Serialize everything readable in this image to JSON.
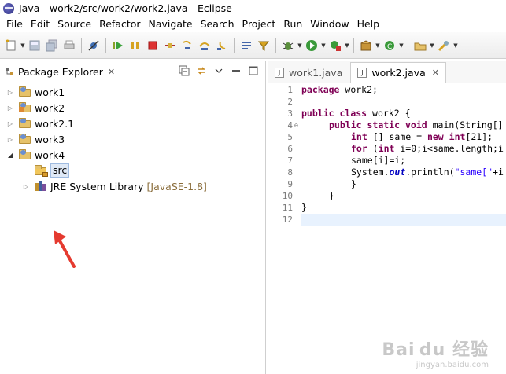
{
  "window": {
    "title": "Java - work2/src/work2/work2.java - Eclipse"
  },
  "menu": [
    "File",
    "Edit",
    "Source",
    "Refactor",
    "Navigate",
    "Search",
    "Project",
    "Run",
    "Window",
    "Help"
  ],
  "package_explorer": {
    "title": "Package Explorer",
    "close_glyph": "✕",
    "projects": [
      {
        "label": "work1",
        "expanded": false
      },
      {
        "label": "work2",
        "expanded": false
      },
      {
        "label": "work2.1",
        "expanded": false
      },
      {
        "label": "work3",
        "expanded": false
      },
      {
        "label": "work4",
        "expanded": true
      }
    ],
    "src_label": "src",
    "library": {
      "label": "JRE System Library",
      "version": "[JavaSE-1.8]"
    }
  },
  "editor": {
    "tabs": [
      {
        "label": "work1.java",
        "active": false
      },
      {
        "label": "work2.java",
        "active": true,
        "close_glyph": "✕"
      }
    ],
    "line_numbers": [
      "1",
      "2",
      "3",
      "4",
      "5",
      "6",
      "7",
      "8",
      "9",
      "10",
      "11",
      "12"
    ],
    "lines": {
      "l1_kw": "package",
      "l1_rest": " work2;",
      "l3_kw1": "public",
      "l3_kw2": "class",
      "l3_rest": " work2 {",
      "l4_kw1": "public",
      "l4_kw2": "static",
      "l4_kw3": "void",
      "l4_rest": " main(String[]",
      "l5_kw": "int",
      "l5_mid": " [] same = ",
      "l5_kw2": "new",
      "l5_kw3": "int",
      "l5_rest": "[21];",
      "l6_kw": "for",
      "l6_mid": " (",
      "l6_kw2": "int",
      "l6_rest": " i=0;i<same.length;i",
      "l7_text": "same[i]=i;",
      "l8_a": "System.",
      "l8_out": "out",
      "l8_b": ".println(",
      "l8_str": "\"same[\"",
      "l8_c": "+i",
      "l9_text": "}",
      "l10_text": "}",
      "l11_text": "}"
    }
  },
  "watermark": {
    "line1": "Bai du 经验",
    "line2": "jingyan.baidu.com"
  },
  "colors": {
    "keyword": "#7f0055",
    "string": "#2a00ff",
    "static_field": "#0000c0",
    "arrow": "#e53a2f"
  }
}
